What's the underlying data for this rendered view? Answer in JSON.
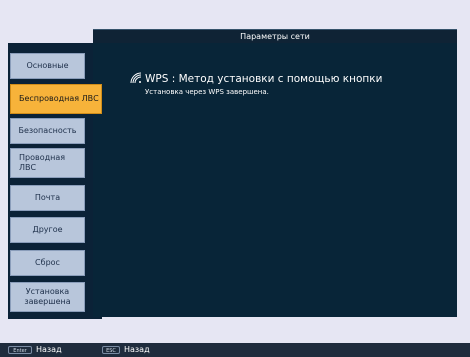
{
  "window": {
    "title": "Параметры сети"
  },
  "sidebar": {
    "items": [
      {
        "label": "Основные"
      },
      {
        "label": "Беспроводная ЛВС"
      },
      {
        "label": "Безопасность"
      },
      {
        "label": "Проводная ЛВС"
      },
      {
        "label": "Почта"
      },
      {
        "label": "Другое"
      },
      {
        "label": "Сброс"
      },
      {
        "label": "Установка завершена"
      }
    ],
    "active_index": 1
  },
  "main": {
    "wps_title": "WPS : Метод установки с помощью кнопки",
    "wps_status": "Установка через WPS завершена.",
    "wps_icon": "wireless-signal-icon"
  },
  "footer": {
    "enter_key": "Enter",
    "enter_label": "Назад",
    "esc_key": "ESC",
    "esc_label": "Назад"
  },
  "colors": {
    "background": "#e6e6f3",
    "panel": "#082538",
    "active_tab": "#f7b33a",
    "inactive_tab": "#b8c6db"
  }
}
